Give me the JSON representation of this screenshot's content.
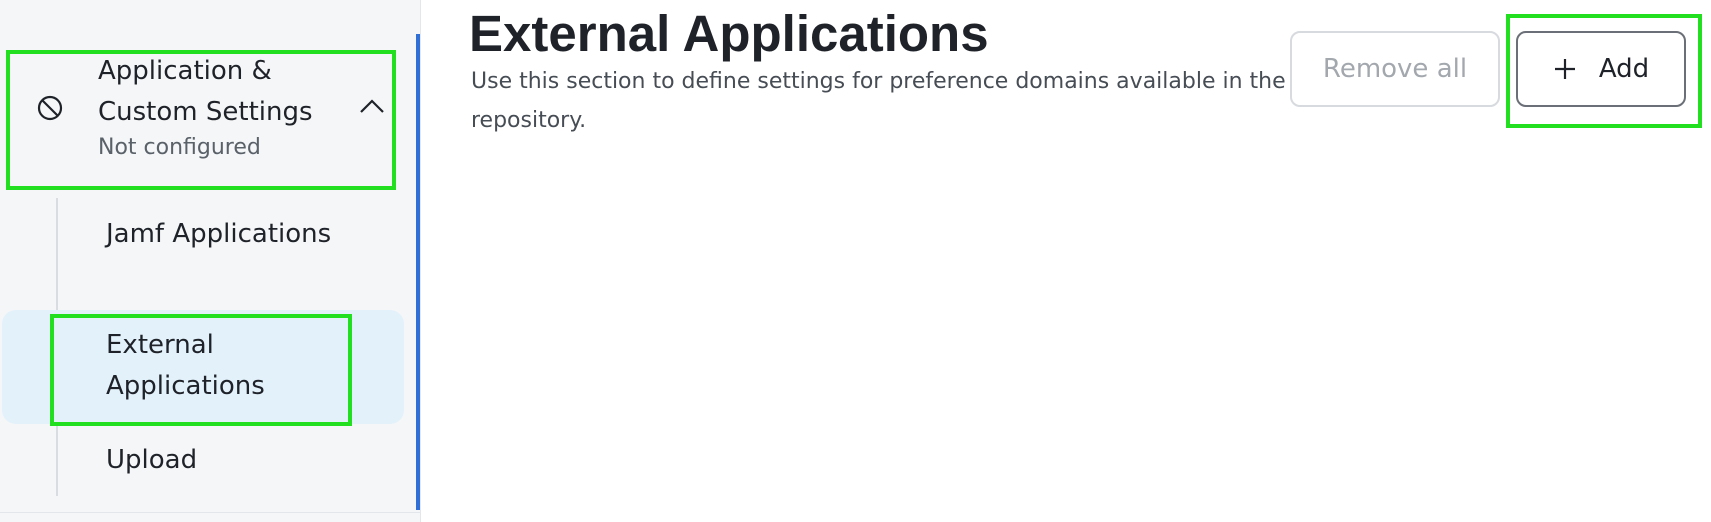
{
  "sidebar": {
    "section": {
      "title": "Application & Custom Settings",
      "status": "Not configured",
      "icon": "prohibited-icon",
      "toggle_icon": "chevron-up-icon"
    },
    "items": [
      {
        "label": "Jamf Applications",
        "active": false
      },
      {
        "label": "External Applications",
        "active": true
      },
      {
        "label": "Upload",
        "active": false
      }
    ]
  },
  "main": {
    "title": "External Applications",
    "description": "Use this section to define settings for preference domains available in the repository.",
    "buttons": {
      "remove_all": "Remove all",
      "add": "Add",
      "add_icon": "plus-icon"
    }
  },
  "colors": {
    "sidebar_background": "#f4f6f8",
    "active_item_background": "#e3f1fb",
    "accent": "#2f6fd6",
    "highlight": "#22e01f"
  }
}
